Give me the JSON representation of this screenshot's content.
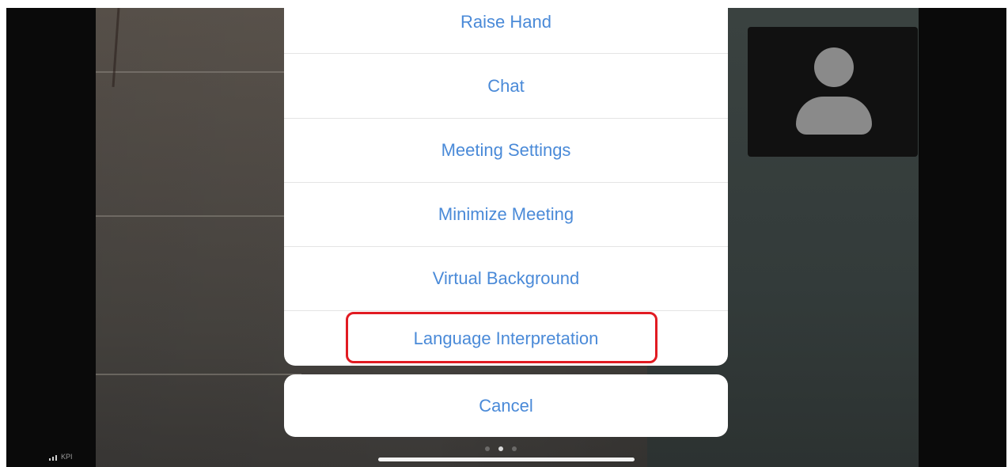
{
  "menu": {
    "items": [
      {
        "label": "Raise Hand"
      },
      {
        "label": "Chat"
      },
      {
        "label": "Meeting Settings"
      },
      {
        "label": "Minimize Meeting"
      },
      {
        "label": "Virtual Background"
      },
      {
        "label": "Language Interpretation",
        "highlighted": true
      }
    ],
    "cancel_label": "Cancel",
    "text_color": "#4a8ad8",
    "highlight_color": "#e11b22"
  },
  "status": {
    "signal_label": "KPI"
  },
  "video": {
    "participant_avatar": "person-silhouette-icon"
  },
  "pager": {
    "count": 3,
    "active_index": 1
  }
}
